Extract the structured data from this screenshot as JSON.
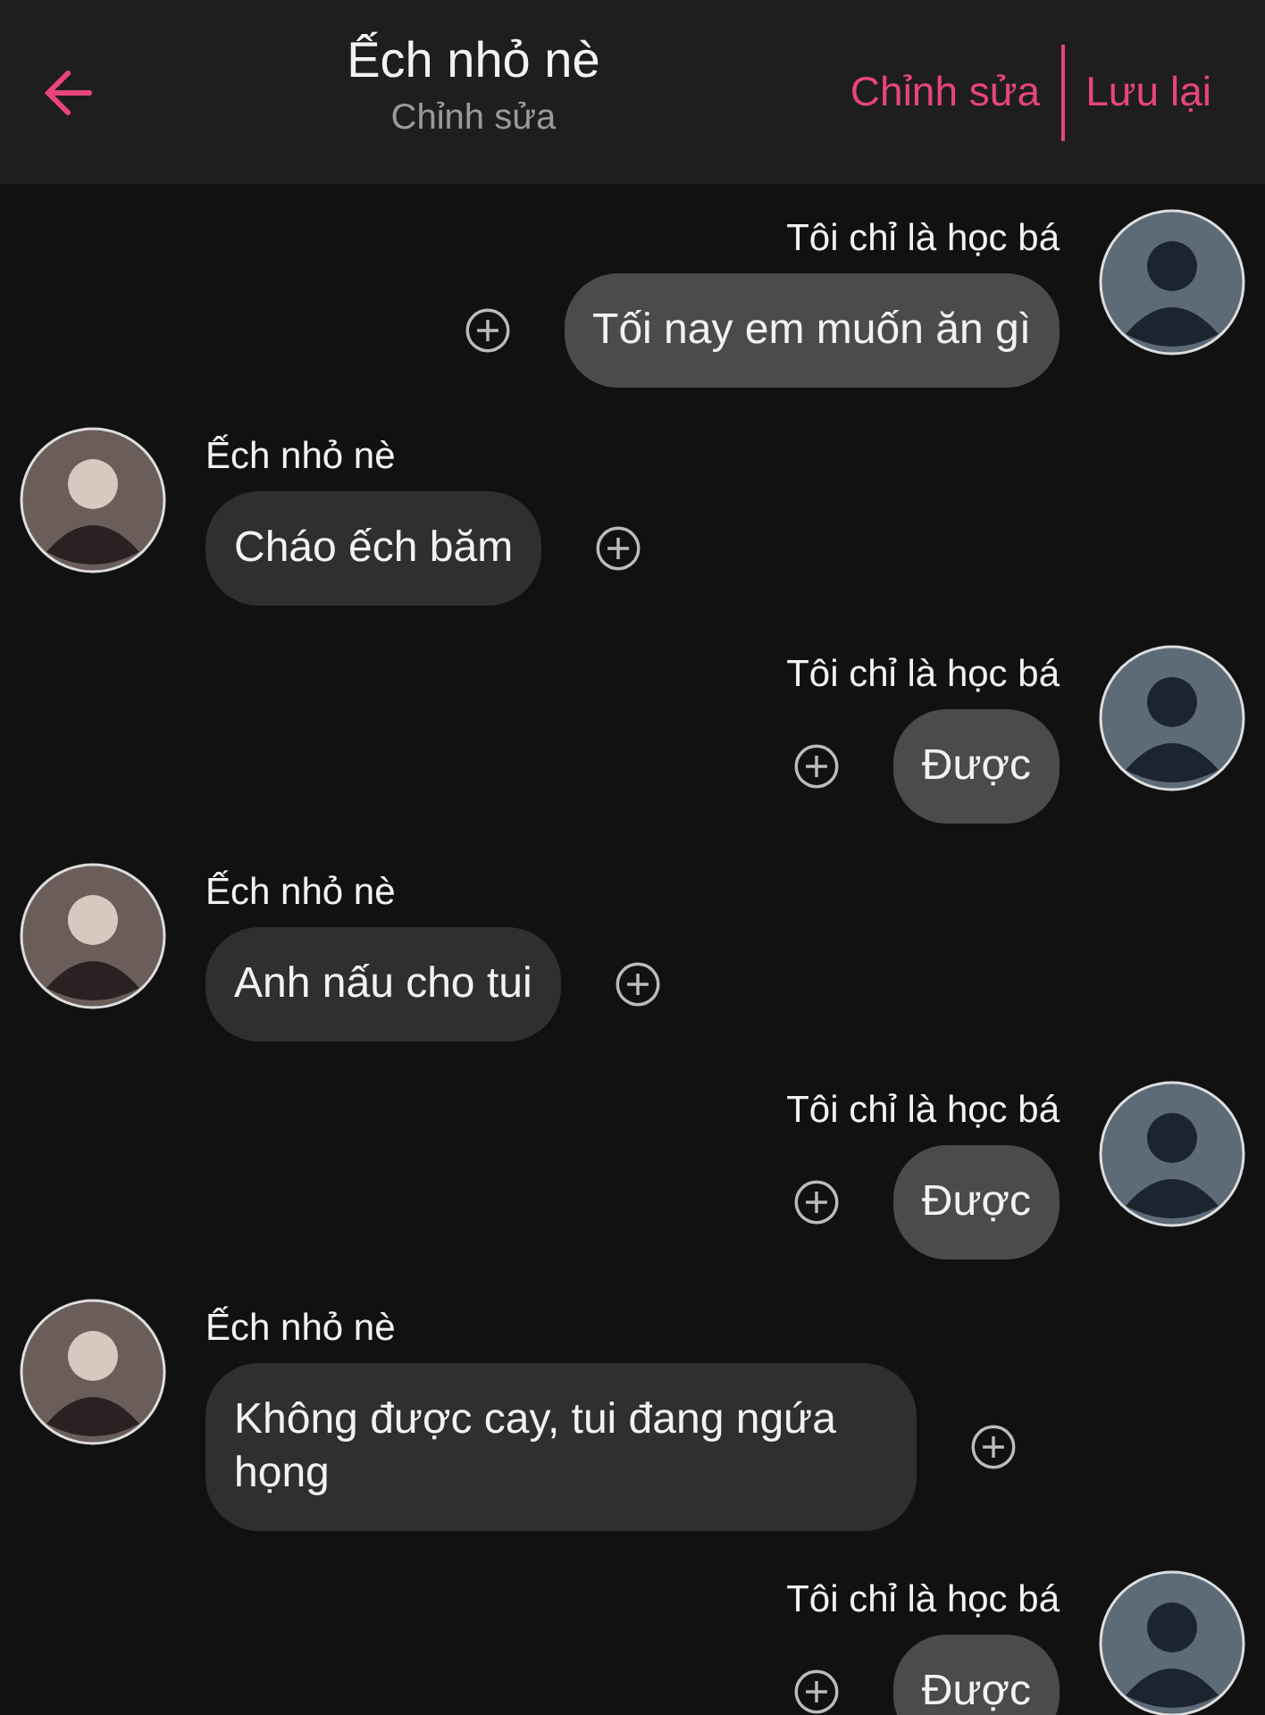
{
  "header": {
    "title": "Ếch nhỏ nè",
    "subtitle": "Chỉnh sửa",
    "actions": [
      "Chỉnh sửa",
      "Lưu lại"
    ]
  },
  "messages": [
    {
      "kind": "sent",
      "sender": "Tôi chỉ là học bá",
      "text": "Tối nay em muốn ăn gì"
    },
    {
      "kind": "received",
      "sender": "Ếch nhỏ nè",
      "text": "Cháo ếch băm"
    },
    {
      "kind": "sent",
      "sender": "Tôi chỉ là học bá",
      "text": "Được"
    },
    {
      "kind": "received",
      "sender": "Ếch nhỏ nè",
      "text": "Anh nấu cho tui"
    },
    {
      "kind": "sent",
      "sender": "Tôi chỉ là học bá",
      "text": "Được"
    },
    {
      "kind": "received",
      "sender": "Ếch nhỏ nè",
      "text": "Không được cay, tui đang ngứa họng"
    },
    {
      "kind": "sent",
      "sender": "Tôi chỉ là học bá",
      "text": "Được"
    }
  ]
}
